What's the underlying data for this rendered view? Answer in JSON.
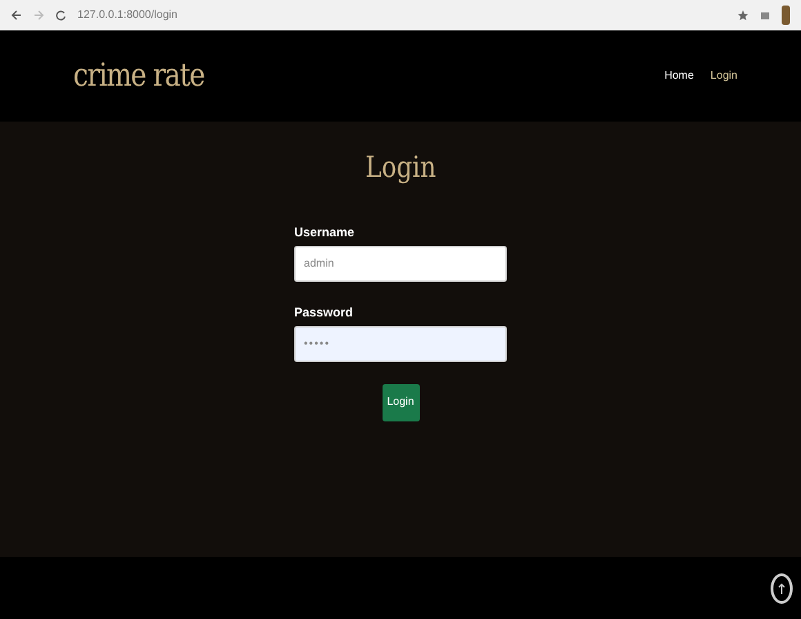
{
  "browser": {
    "address": "127.0.0.1:8000/login"
  },
  "navbar": {
    "brand": "crime rate",
    "links": [
      {
        "label": "Home",
        "selected": false
      },
      {
        "label": "Login",
        "selected": true
      }
    ]
  },
  "form": {
    "title": "Login",
    "fields": [
      {
        "label": "Username",
        "value": "admin",
        "kind": "text"
      },
      {
        "label": "Password",
        "value": "•••••",
        "kind": "password"
      }
    ],
    "submit": "Login"
  }
}
